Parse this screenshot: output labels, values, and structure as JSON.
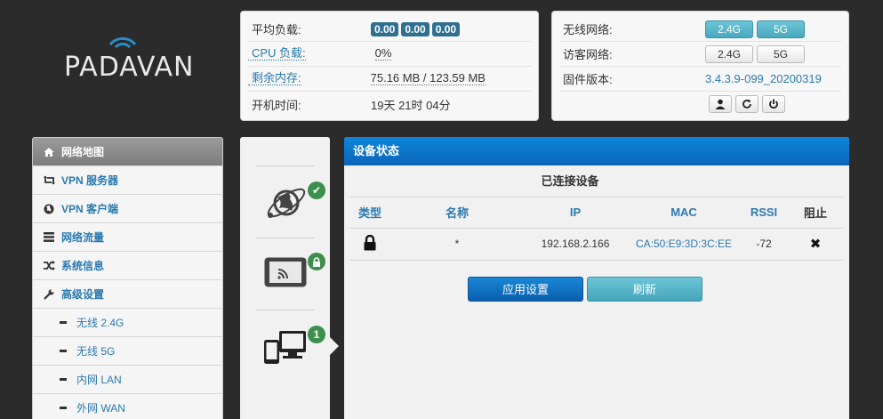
{
  "brand": {
    "logo_text": "PADAVAN"
  },
  "stats": {
    "load_label": "平均负载:",
    "load_values": [
      "0.00",
      "0.00",
      "0.00"
    ],
    "cpu_label": "CPU 负载:",
    "cpu_value": "0%",
    "mem_label": "剩余内存:",
    "mem_value": "75.16 MB / 123.59 MB",
    "uptime_label": "开机时间:",
    "uptime_value": "19天 21时 04分"
  },
  "wifi": {
    "wireless_label": "无线网络:",
    "guest_label": "访客网络:",
    "firmware_label": "固件版本:",
    "band_24": "2.4G",
    "band_5": "5G",
    "firmware_value": "3.4.3.9-099_20200319"
  },
  "sidebar": {
    "items": [
      {
        "label": "网络地图",
        "icon": "home-icon"
      },
      {
        "label": "VPN 服务器",
        "icon": "retweet-icon"
      },
      {
        "label": "VPN 客户端",
        "icon": "globe-icon"
      },
      {
        "label": "网络流量",
        "icon": "list-icon"
      },
      {
        "label": "系统信息",
        "icon": "random-icon"
      },
      {
        "label": "高级设置",
        "icon": "wrench-icon"
      }
    ],
    "subitems": [
      {
        "label": "无线 2.4G"
      },
      {
        "label": "无线 5G"
      },
      {
        "label": "内网 LAN"
      },
      {
        "label": "外网 WAN"
      }
    ]
  },
  "midcol": {
    "clients_count": "1"
  },
  "device_status": {
    "title": "设备状态",
    "caption": "已连接设备",
    "columns": [
      "类型",
      "名称",
      "IP",
      "MAC",
      "RSSI",
      "阻止"
    ],
    "rows": [
      {
        "type_icon": "lock-icon",
        "name": "*",
        "ip": "192.168.2.166",
        "mac": "CA:50:E9:3D:3C:EE",
        "rssi": "-72",
        "block_icon": "close-icon"
      }
    ],
    "apply_label": "应用设置",
    "refresh_label": "刷新"
  },
  "colors": {
    "background": "#2b2b2b",
    "accent_blue": "#0a66b8",
    "link_blue": "#2a7ab0",
    "status_green": "#3e8f4c",
    "badge_blue": "#2f6f91"
  }
}
